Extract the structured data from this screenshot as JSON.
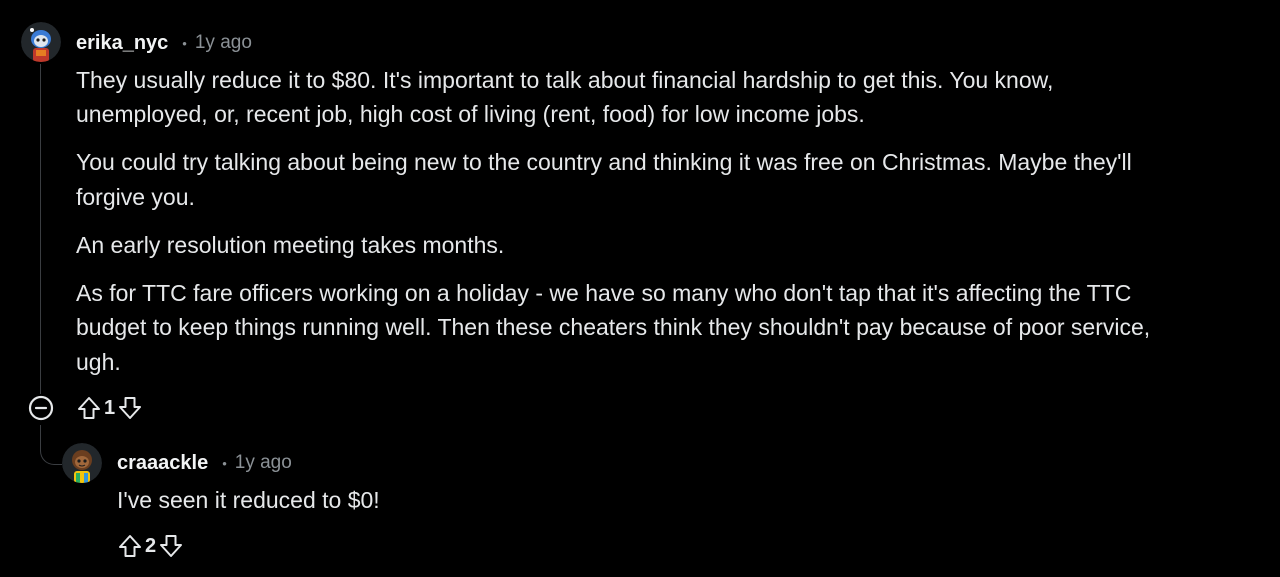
{
  "comments": [
    {
      "username": "erika_nyc",
      "separator": "•",
      "time": "1y ago",
      "avatar_icon": "snoo-avatar-blue",
      "paragraphs": [
        "They usually reduce it to $80. It's important to talk about financial hardship to get this. You know,",
        "unemployed, or, recent job, high cost of living (rent, food) for low income jobs.",
        "You could try talking about being new to the country and thinking it was free on Christmas. Maybe they'll",
        "forgive you.",
        "An early resolution meeting takes months.",
        "As for TTC fare officers working on a holiday - we have so many who don't tap that it's affecting the TTC",
        "budget to keep things running well. Then these cheaters think they shouldn't pay because of poor service,",
        "ugh."
      ],
      "vote_count": "1"
    },
    {
      "username": "craaackle",
      "separator": "•",
      "time": "1y ago",
      "avatar_icon": "snoo-avatar-brown",
      "paragraphs": [
        "I've seen it reduced to $0!"
      ],
      "vote_count": "2"
    }
  ],
  "colors": {
    "background": "#000000",
    "text": "#e6e8ea",
    "muted": "#8b9196",
    "thread_line": "#3a3d41"
  }
}
